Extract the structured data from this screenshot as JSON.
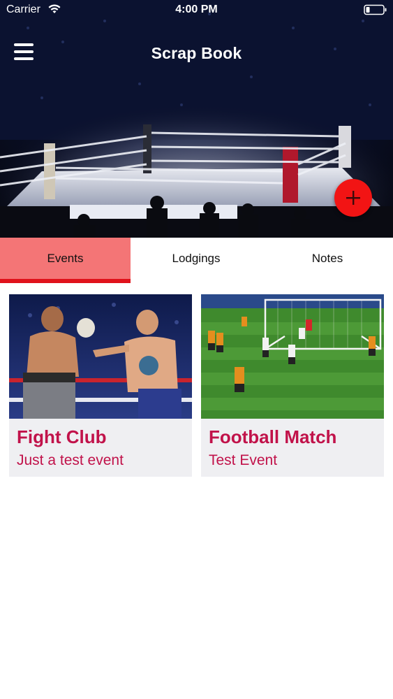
{
  "status_bar": {
    "carrier": "Carrier",
    "time": "4:00 PM"
  },
  "header": {
    "title": "Scrap Book",
    "menu_icon": "hamburger-menu-icon",
    "add_icon": "plus-icon",
    "fab_color": "#f21414"
  },
  "tabs": [
    {
      "label": "Events",
      "active": true
    },
    {
      "label": "Lodgings",
      "active": false
    },
    {
      "label": "Notes",
      "active": false
    }
  ],
  "colors": {
    "active_tab_bg": "#f47576",
    "active_tab_indicator": "#e0121b",
    "card_text": "#c1124a",
    "card_bg": "#efeff2"
  },
  "events": [
    {
      "title": "Fight Club",
      "subtitle": "Just a test event",
      "image": "boxing-match-photo"
    },
    {
      "title": "Football Match",
      "subtitle": "Test Event",
      "image": "football-match-photo"
    }
  ]
}
